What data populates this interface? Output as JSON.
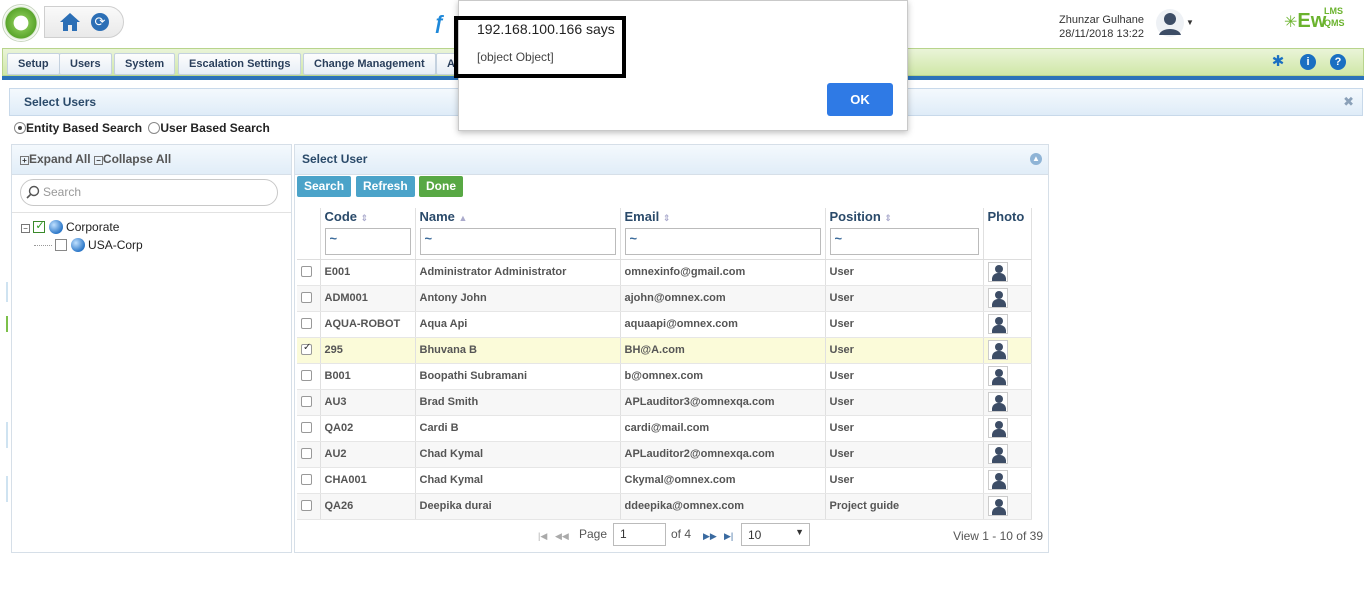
{
  "header": {
    "user_name": "Zhunzar Gulhane",
    "user_date": "28/11/2018 13:22",
    "brand": "Ew",
    "brand_sup": "LMS",
    "brand_sub": "QMS"
  },
  "nav": {
    "items": [
      "Setup",
      "Users",
      "System",
      "Escalation Settings",
      "Change Management",
      "A"
    ]
  },
  "panel": {
    "title": "Select Users",
    "search_modes": [
      "Entity Based Search",
      "User Based Search"
    ],
    "selected_mode": "Entity Based Search"
  },
  "tree": {
    "expand_all": "Expand All",
    "collapse_all": "Collapse All",
    "search_placeholder": "Search",
    "nodes": [
      {
        "label": "Corporate",
        "checked": true
      },
      {
        "label": "USA-Corp",
        "checked": false
      }
    ]
  },
  "grid": {
    "title": "Select User",
    "buttons": {
      "search": "Search",
      "refresh": "Refresh",
      "done": "Done"
    },
    "columns": [
      "Code",
      "Name",
      "Email",
      "Position",
      "Photo"
    ],
    "filter_value": "~",
    "rows": [
      {
        "code": "E001",
        "name": "Administrator Administrator",
        "email": "omnexinfo@gmail.com",
        "position": "User",
        "checked": false
      },
      {
        "code": "ADM001",
        "name": "Antony John",
        "email": "ajohn@omnex.com",
        "position": "User",
        "checked": false
      },
      {
        "code": "AQUA-ROBOT",
        "name": "Aqua Api",
        "email": "aquaapi@omnex.com",
        "position": "User",
        "checked": false
      },
      {
        "code": "295",
        "name": "Bhuvana  B",
        "email": "BH@A.com",
        "position": "User",
        "checked": true
      },
      {
        "code": "B001",
        "name": "Boopathi Subramani",
        "email": "b@omnex.com",
        "position": "User",
        "checked": false
      },
      {
        "code": "AU3",
        "name": "Brad Smith",
        "email": "APLauditor3@omnexqa.com",
        "position": "User",
        "checked": false
      },
      {
        "code": "QA02",
        "name": "Cardi  B",
        "email": "cardi@mail.com",
        "position": "User",
        "checked": false
      },
      {
        "code": "AU2",
        "name": "Chad Kymal",
        "email": "APLauditor2@omnexqa.com",
        "position": "User",
        "checked": false
      },
      {
        "code": "CHA001",
        "name": "Chad Kymal",
        "email": "Ckymal@omnex.com",
        "position": "User",
        "checked": false
      },
      {
        "code": "QA26",
        "name": "Deepika durai",
        "email": "ddeepika@omnex.com",
        "position": "Project guide",
        "checked": false
      }
    ]
  },
  "pager": {
    "page_label": "Page",
    "page_value": "1",
    "of_label": "of 4",
    "page_size": "10",
    "view_text": "View 1 - 10 of 39"
  },
  "alert": {
    "title": "192.168.100.166 says",
    "message": "[object Object]",
    "ok_label": "OK"
  },
  "colors": {
    "accent": "#2f7ae5",
    "nav_green": "#cfe7a7",
    "done_green": "#58a844",
    "button_blue": "#4ba3c9"
  }
}
